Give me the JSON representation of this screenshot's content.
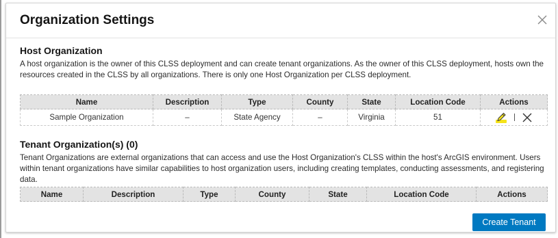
{
  "dialog": {
    "title": "Organization Settings",
    "close_icon": "close-icon"
  },
  "host": {
    "title": "Host Organization",
    "description": "A host organization is the owner of this CLSS deployment and can create tenant organizations. As the owner of this CLSS deployment, hosts own the resources created in the CLSS by all organizations. There is only one Host Organization per CLSS deployment.",
    "columns": [
      "Name",
      "Description",
      "Type",
      "County",
      "State",
      "Location Code",
      "Actions"
    ],
    "rows": [
      {
        "name": "Sample Organization",
        "description": "–",
        "type": "State Agency",
        "county": "–",
        "state": "Virginia",
        "location_code": "51",
        "actions": [
          "edit-icon",
          "close-icon"
        ]
      }
    ]
  },
  "tenant": {
    "title": "Tenant Organization(s) (0)",
    "description": "Tenant Organizations are external organizations that can access and use the Host Organization's CLSS within the host's ArcGIS environment. Users within tenant organizations have similar capabilities to host organization users, including creating templates, conducting assessments, and registering data.",
    "columns": [
      "Name",
      "Description",
      "Type",
      "County",
      "State",
      "Location Code",
      "Actions"
    ]
  },
  "create_button": {
    "label": "Create Tenant"
  },
  "colors": {
    "primary": "#0079c1",
    "header_bg": "#e3e3e3",
    "edit_highlight": "#f5e31a"
  }
}
